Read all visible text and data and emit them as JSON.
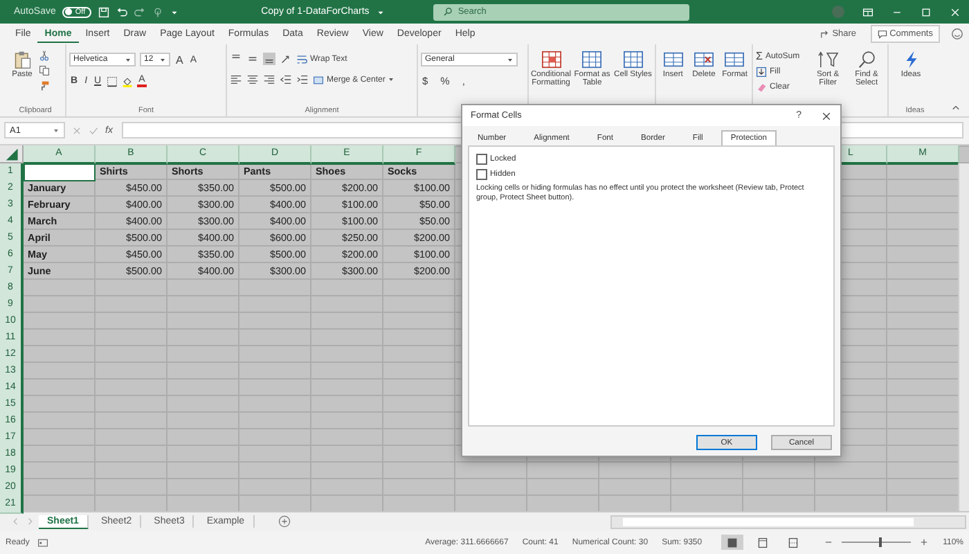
{
  "title_bar": {
    "autosave_label": "AutoSave",
    "autosave_toggle": {
      "on": false,
      "label": "Off"
    },
    "document_title": "Copy of 1-DataForCharts",
    "search": {
      "placeholder": "Search"
    }
  },
  "ribbon_tabs": [
    {
      "label": "File",
      "selected": false
    },
    {
      "label": "Home",
      "selected": true
    },
    {
      "label": "Insert",
      "selected": false
    },
    {
      "label": "Draw",
      "selected": false
    },
    {
      "label": "Page Layout",
      "selected": false
    },
    {
      "label": "Formulas",
      "selected": false
    },
    {
      "label": "Data",
      "selected": false
    },
    {
      "label": "Review",
      "selected": false
    },
    {
      "label": "View",
      "selected": false
    },
    {
      "label": "Developer",
      "selected": false
    },
    {
      "label": "Help",
      "selected": false
    }
  ],
  "share_button": "Share",
  "comments_button": "Comments",
  "ribbon": {
    "clipboard": {
      "paste": "Paste",
      "group_label": "Clipboard"
    },
    "font": {
      "font_name": "Helvetica",
      "font_size": "12",
      "size_buttons": [
        "A",
        "A"
      ],
      "format_buttons": [
        "B",
        "I",
        "U"
      ],
      "font_color_button": "A",
      "group_label": "Font"
    },
    "alignment": {
      "vertical_align": [
        {
          "selected": false
        },
        {
          "selected": false
        },
        {
          "selected": true
        }
      ],
      "wrap_text": "Wrap Text",
      "merge_center": "Merge & Center",
      "group_label": "Alignment"
    },
    "number": {
      "format": "General",
      "buttons": [
        "$",
        "%",
        ","
      ]
    },
    "styles": [
      "Conditional Formatting",
      "Format as Table",
      "Cell Styles"
    ],
    "cells": [
      "Insert",
      "Delete",
      "Format"
    ],
    "editing": {
      "autosum_symbol": "Σ",
      "autosum": "AutoSum",
      "fill": "Fill",
      "clear": "Clear",
      "sort_filter": "Sort & Filter",
      "find_select": "Find & Select"
    },
    "ideas": {
      "button": "Ideas",
      "group_label": "Ideas"
    }
  },
  "formula_bar": {
    "name_box": "A1",
    "function_label": "fx"
  },
  "sheet": {
    "columns_left": [
      "A",
      "B",
      "C",
      "D",
      "E",
      "F"
    ],
    "columns_right": [
      "L",
      "M"
    ],
    "rows": [
      {
        "number": "1",
        "kind": "header",
        "a_cell_active": true,
        "cells": [
          null,
          "Shirts",
          "Shorts",
          "Pants",
          "Shoes",
          "Socks"
        ]
      },
      {
        "number": "2",
        "kind": "data",
        "a_cell_active": false,
        "cells": [
          "January",
          "$450.00",
          "$350.00",
          "$500.00",
          "$200.00",
          "$100.00"
        ]
      },
      {
        "number": "3",
        "kind": "data",
        "a_cell_active": false,
        "cells": [
          "February",
          "$400.00",
          "$300.00",
          "$400.00",
          "$100.00",
          "$50.00"
        ]
      },
      {
        "number": "4",
        "kind": "data",
        "a_cell_active": false,
        "cells": [
          "March",
          "$400.00",
          "$300.00",
          "$400.00",
          "$100.00",
          "$50.00"
        ]
      },
      {
        "number": "5",
        "kind": "data",
        "a_cell_active": false,
        "cells": [
          "April",
          "$500.00",
          "$400.00",
          "$600.00",
          "$250.00",
          "$200.00"
        ]
      },
      {
        "number": "6",
        "kind": "data",
        "a_cell_active": false,
        "cells": [
          "May",
          "$450.00",
          "$350.00",
          "$500.00",
          "$200.00",
          "$100.00"
        ]
      },
      {
        "number": "7",
        "kind": "data",
        "a_cell_active": false,
        "cells": [
          "June",
          "$500.00",
          "$400.00",
          "$300.00",
          "$300.00",
          "$200.00"
        ]
      },
      {
        "number": "8",
        "kind": "empty",
        "a_cell_active": false
      },
      {
        "number": "9",
        "kind": "empty",
        "a_cell_active": false
      },
      {
        "number": "10",
        "kind": "empty",
        "a_cell_active": false
      },
      {
        "number": "11",
        "kind": "empty",
        "a_cell_active": false
      },
      {
        "number": "12",
        "kind": "empty",
        "a_cell_active": false
      },
      {
        "number": "13",
        "kind": "empty",
        "a_cell_active": false
      },
      {
        "number": "14",
        "kind": "empty",
        "a_cell_active": false
      },
      {
        "number": "15",
        "kind": "empty",
        "a_cell_active": false
      },
      {
        "number": "16",
        "kind": "empty",
        "a_cell_active": false
      },
      {
        "number": "17",
        "kind": "empty",
        "a_cell_active": false
      },
      {
        "number": "18",
        "kind": "empty",
        "a_cell_active": false
      },
      {
        "number": "19",
        "kind": "empty",
        "a_cell_active": false
      },
      {
        "number": "20",
        "kind": "empty",
        "a_cell_active": false
      },
      {
        "number": "21",
        "kind": "empty",
        "a_cell_active": false
      }
    ]
  },
  "sheet_tabs": [
    {
      "label": "Sheet1",
      "selected": true
    },
    {
      "label": "Sheet2",
      "selected": false
    },
    {
      "label": "Sheet3",
      "selected": false
    },
    {
      "label": "Example",
      "selected": false
    }
  ],
  "status_bar": {
    "mode": "Ready",
    "stats": [
      "Average: 311.6666667",
      "Count: 41",
      "Numerical Count: 30",
      "Sum: 9350"
    ],
    "views": [
      {
        "kind": "normal",
        "selected": true
      },
      {
        "kind": "page_layout",
        "selected": false
      },
      {
        "kind": "page_break",
        "selected": false
      }
    ],
    "zoom": {
      "level": 0.55,
      "label": "110%"
    }
  },
  "dialog": {
    "title": "Format Cells",
    "help": "?",
    "tabs": [
      {
        "label": "Number",
        "selected": false
      },
      {
        "label": "Alignment",
        "selected": false
      },
      {
        "label": "Font",
        "selected": false
      },
      {
        "label": "Border",
        "selected": false
      },
      {
        "label": "Fill",
        "selected": false
      },
      {
        "label": "Protection",
        "selected": true
      }
    ],
    "options": [
      {
        "label": "Locked",
        "checked": false
      },
      {
        "label": "Hidden",
        "checked": false
      }
    ],
    "note": "Locking cells or hiding formulas has no effect until you protect the worksheet (Review tab, Protect group, Protect Sheet button).",
    "buttons": [
      {
        "label": "OK",
        "default": true
      },
      {
        "label": "Cancel",
        "default": false
      }
    ]
  }
}
